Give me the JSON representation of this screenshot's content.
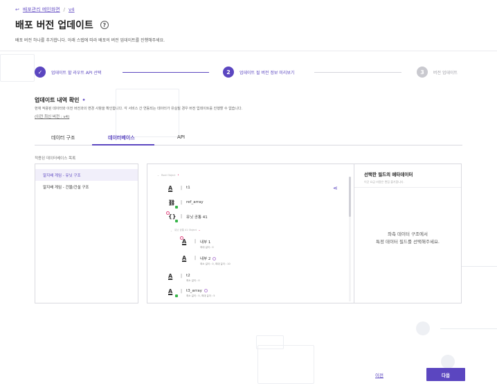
{
  "breadcrumb": {
    "back_label": "배포관리 메인화면",
    "separator": "/",
    "current": "v4"
  },
  "header": {
    "title": "배포 버전 업데이트",
    "help_icon": "?",
    "description": "배포 버전 하나를 추가합니다. 아래 스텝에 따라 배포의 버전 업데이트를 진행해주세요."
  },
  "stepper": {
    "steps": [
      {
        "number": "✓",
        "label": "업데이트 할 라우트 API 선택",
        "state": "done"
      },
      {
        "number": "2",
        "label": "업데이트 될 버전 정보 미리보기",
        "state": "active"
      },
      {
        "number": "3",
        "label": "버전 업데이트",
        "state": "todo"
      }
    ]
  },
  "section": {
    "title": "업데이트 내역 확인",
    "required_dot": "•",
    "description": "현재 적용된 데이터와 이전 버전과의 변경 사항을 확인합니다. 각 서비스 간 연동되는 데이터가 유실될 경우 버전 업데이트를 진행할 수 없습니다.",
    "prev_version": "(이전 최신 버전 : v4)"
  },
  "tabs": [
    {
      "label": "데이터 구조",
      "active": false
    },
    {
      "label": "데이터베이스",
      "active": true
    },
    {
      "label": "API",
      "active": false
    }
  ],
  "db_list": {
    "label": "적용된 데이터베이스 목록",
    "items": [
      {
        "label": "알지배 게임 - 유닛 구조",
        "selected": true
      },
      {
        "label": "알지배 게임 - 건물/건설 구조",
        "selected": false
      }
    ]
  },
  "tree": {
    "root_label": "Root Object",
    "root_required": "•",
    "sub_group_label": "유닛 공통 41 Object",
    "sub_group_required": "•",
    "fields": [
      {
        "name": "t1",
        "meta": "",
        "icon": "text-field-icon"
      },
      {
        "name": "ref_array",
        "meta": "",
        "icon": "link-icon"
      },
      {
        "name": "유닛 공통 41",
        "meta": "",
        "icon": "object-icon"
      },
      {
        "name": "내부 1",
        "meta": "최대 길이 : 0",
        "icon": "text-field-icon"
      },
      {
        "name": "내부 2",
        "meta": "최소 길이 : 0, 최대 길이 : 10",
        "icon": "text-field-icon"
      },
      {
        "name": "t2",
        "meta": "최소 길이 : 0",
        "icon": "text-field-icon"
      },
      {
        "name": "t3_array",
        "meta": "최소 길이 : 5, 최대 길이 : 5",
        "icon": "text-field-icon"
      }
    ],
    "share_icon": "share-icon"
  },
  "metadata_panel": {
    "title": "선택한 필드의 메타데이터",
    "subtitle": "이곳 요금 비용은 편집 불가합니다.",
    "empty_line1": "좌측 데이터 구조에서",
    "empty_line2": "특정 데이터 필드를 선택해주세요."
  },
  "footer": {
    "prev_label": "이전",
    "next_label": "다음"
  },
  "colors": {
    "accent": "#5b46c0",
    "inactive": "#c9c9cf",
    "required": "#e0447e",
    "badge": "#38b54a"
  }
}
